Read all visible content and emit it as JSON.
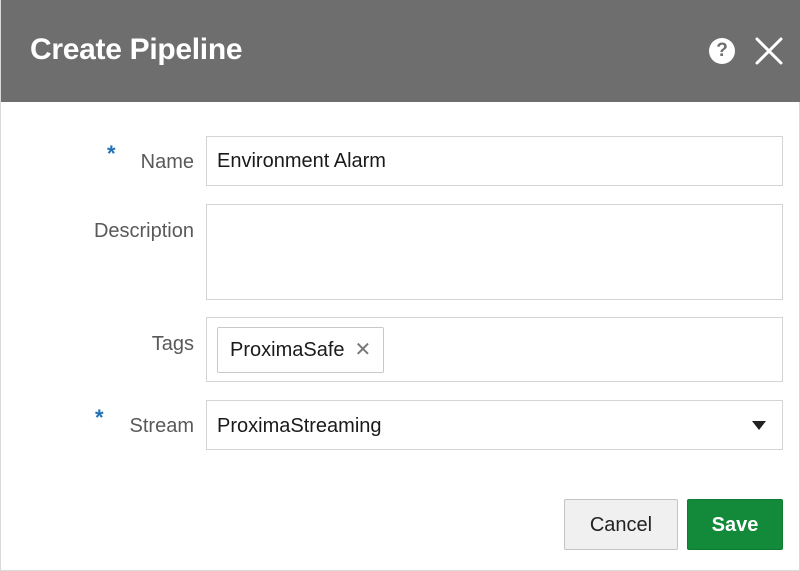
{
  "dialog": {
    "title": "Create Pipeline",
    "help_icon_glyph": "?",
    "help_icon": "question-circle-icon",
    "close_icon": "close-x-icon"
  },
  "form": {
    "required_marker": "*",
    "name": {
      "label": "Name",
      "value": "Environment Alarm",
      "required": true
    },
    "description": {
      "label": "Description",
      "value": ""
    },
    "tags": {
      "label": "Tags",
      "items": [
        {
          "label": "ProximaSafe",
          "remove_glyph": "✕"
        }
      ]
    },
    "stream": {
      "label": "Stream",
      "value": "ProximaStreaming",
      "required": true
    }
  },
  "buttons": {
    "cancel": "Cancel",
    "save": "Save"
  },
  "colors": {
    "header_bg": "#6e6e6e",
    "required_marker": "#1f6fb5",
    "save_bg": "#13893a"
  }
}
